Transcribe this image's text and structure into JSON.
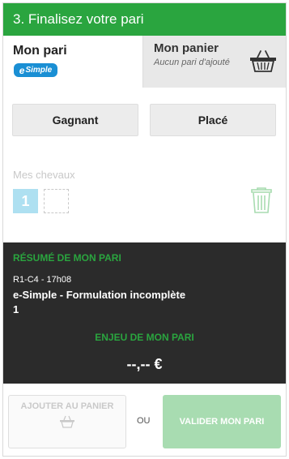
{
  "header": {
    "title": "3. Finalisez votre pari"
  },
  "tabs": {
    "pari": {
      "title": "Mon pari",
      "logo_e": "e",
      "logo_text": "Simple"
    },
    "panier": {
      "title": "Mon panier",
      "subtitle": "Aucun pari d'ajouté"
    }
  },
  "bet_types": {
    "gagnant": "Gagnant",
    "place": "Placé"
  },
  "chevaux": {
    "label": "Mes chevaux",
    "selected": [
      "1"
    ]
  },
  "resume": {
    "title": "RÉSUMÉ DE MON PARI",
    "course": "R1-C4 - 17h08",
    "formulation": "e-Simple - Formulation incomplète",
    "numbers": "1",
    "enjeu_title": "ENJEU DE MON PARI",
    "amount": "--,-- €"
  },
  "footer": {
    "ajouter_label": "AJOUTER AU PANIER",
    "ou": "OU",
    "valider_label": "VALIDER MON PARI"
  },
  "colors": {
    "brand_green": "#2aa53f",
    "dark_panel": "#2b2b2b",
    "slot_blue": "#aee0f1",
    "esimple_blue": "#1a8fd4"
  }
}
